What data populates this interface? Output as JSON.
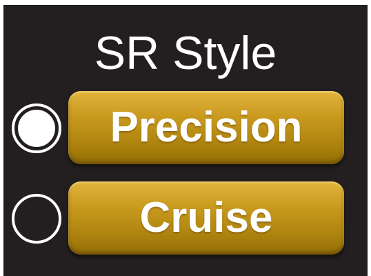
{
  "title": "SR Style",
  "options": [
    {
      "label": "Precision",
      "selected": true
    },
    {
      "label": "Cruise",
      "selected": false
    }
  ],
  "colors": {
    "background": "#231f20",
    "button_gold": "#c99a1e",
    "text": "#ffffff"
  }
}
